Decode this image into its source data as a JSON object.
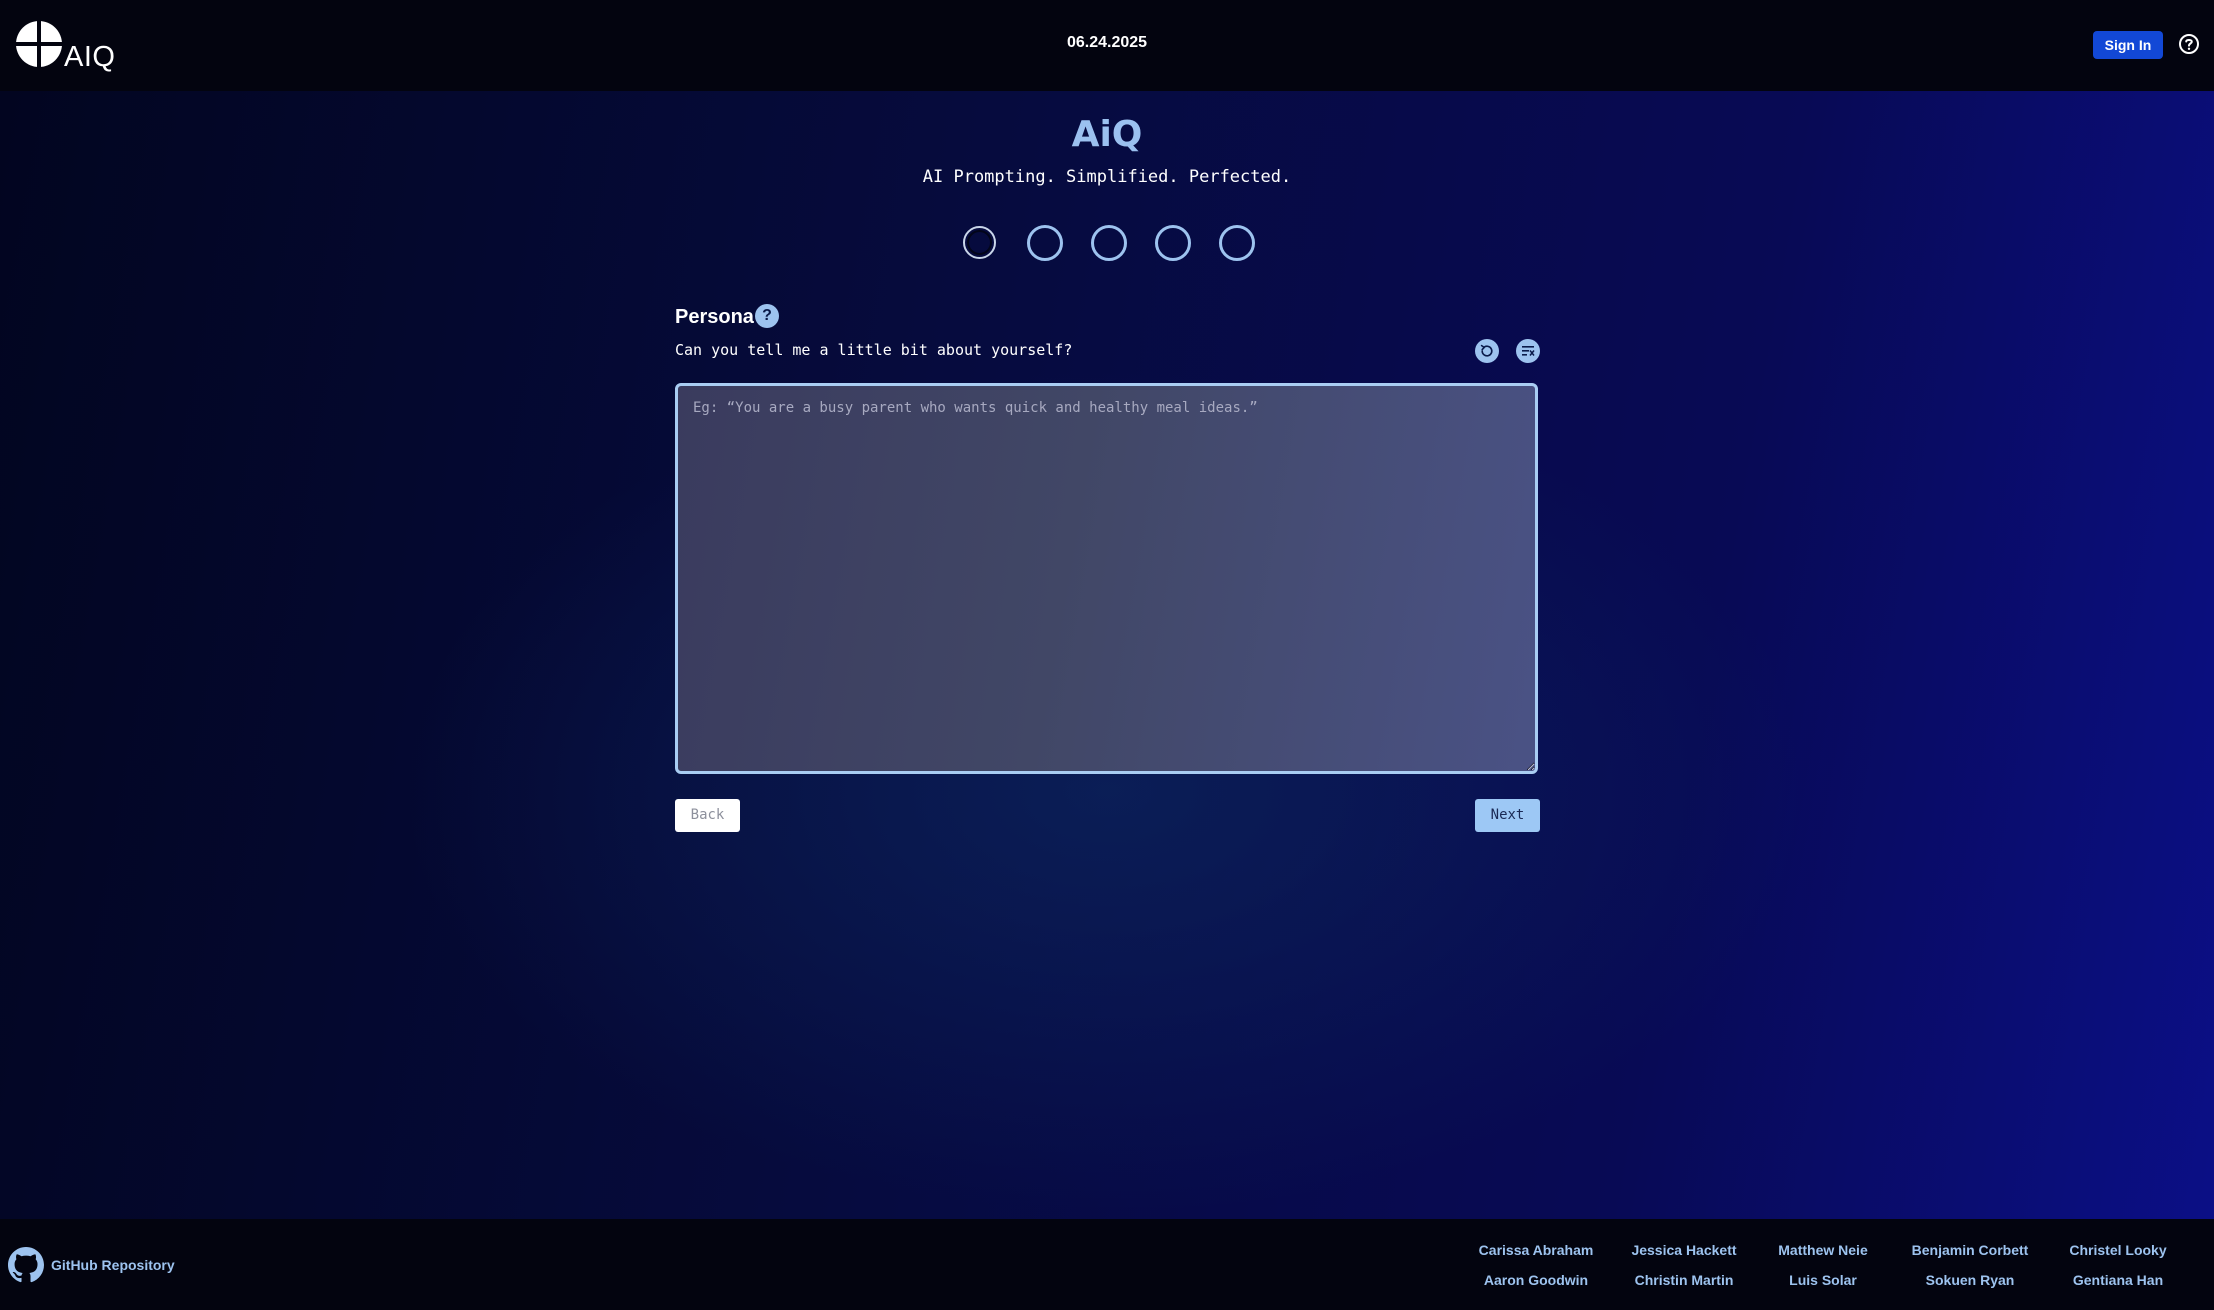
{
  "header": {
    "logo_text": "AIQ",
    "date": "06.24.2025",
    "sign_in_label": "Sign In"
  },
  "hero": {
    "title": "AiQ",
    "subtitle": "AI Prompting. Simplified. Perfected."
  },
  "stepper": {
    "total_steps": 5,
    "current_step": 1
  },
  "form": {
    "section_title": "Persona",
    "help_symbol": "?",
    "question": "Can you tell me a little bit about yourself?",
    "input_value": "",
    "input_placeholder": "Eg: “You are a busy parent who wants quick and healthy meal ideas.”",
    "back_label": "Back",
    "next_label": "Next"
  },
  "footer": {
    "github_label": "GitHub Repository",
    "contributors_row1": [
      "Carissa Abraham",
      "Jessica Hackett",
      "Matthew Neie",
      "Benjamin Corbett",
      "Christel Looky"
    ],
    "contributors_row2": [
      "Aaron Goodwin",
      "Christin Martin",
      "Luis Solar",
      "Sokuen Ryan",
      "Gentiana Han"
    ]
  },
  "colors": {
    "accent": "#9dc3ef",
    "sign_in_bg": "#1248d6",
    "header_bg": "#03040f"
  }
}
